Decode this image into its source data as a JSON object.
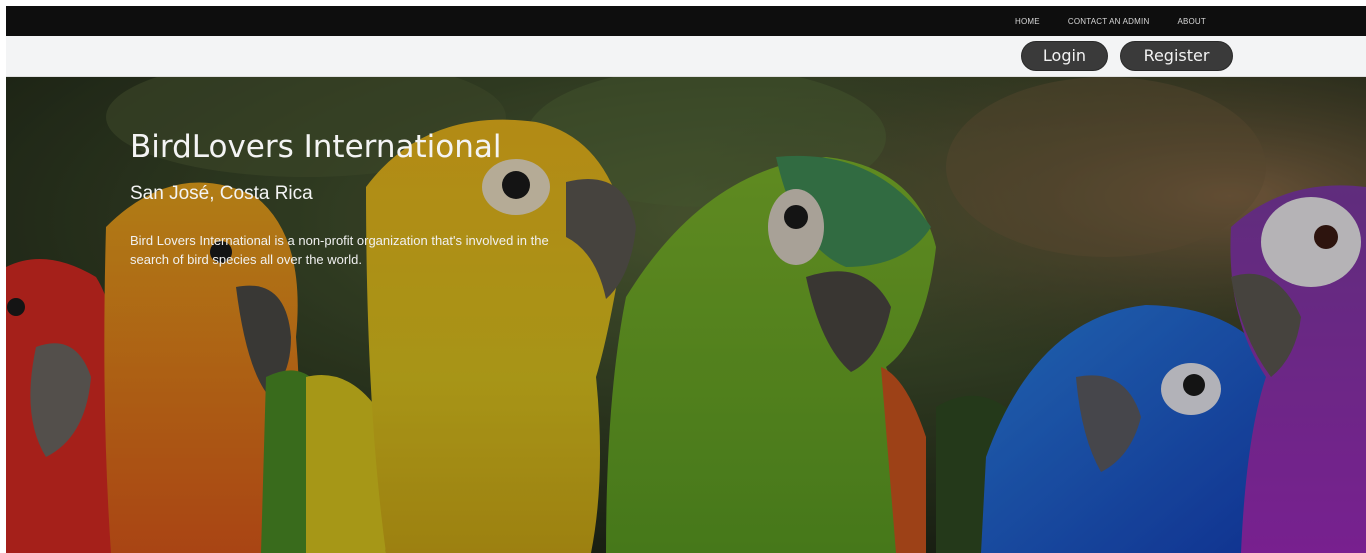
{
  "nav": {
    "links": [
      {
        "label": "HOME"
      },
      {
        "label": "CONTACT AN ADMIN"
      },
      {
        "label": "ABOUT"
      }
    ]
  },
  "auth": {
    "login_label": "Login",
    "register_label": "Register"
  },
  "hero": {
    "title": "BirdLovers International",
    "subtitle": "San José, Costa Rica",
    "description": "Bird Lovers International is a non-profit organization that's involved in the search of bird species all over the world."
  },
  "colors": {
    "topnav_bg": "#0e0e0e",
    "authbar_bg": "#f3f4f5",
    "button_bg": "#3a3a3a",
    "text_light": "#f4f4f4"
  },
  "icons": {
    "hero_image": "parrots-photo"
  }
}
